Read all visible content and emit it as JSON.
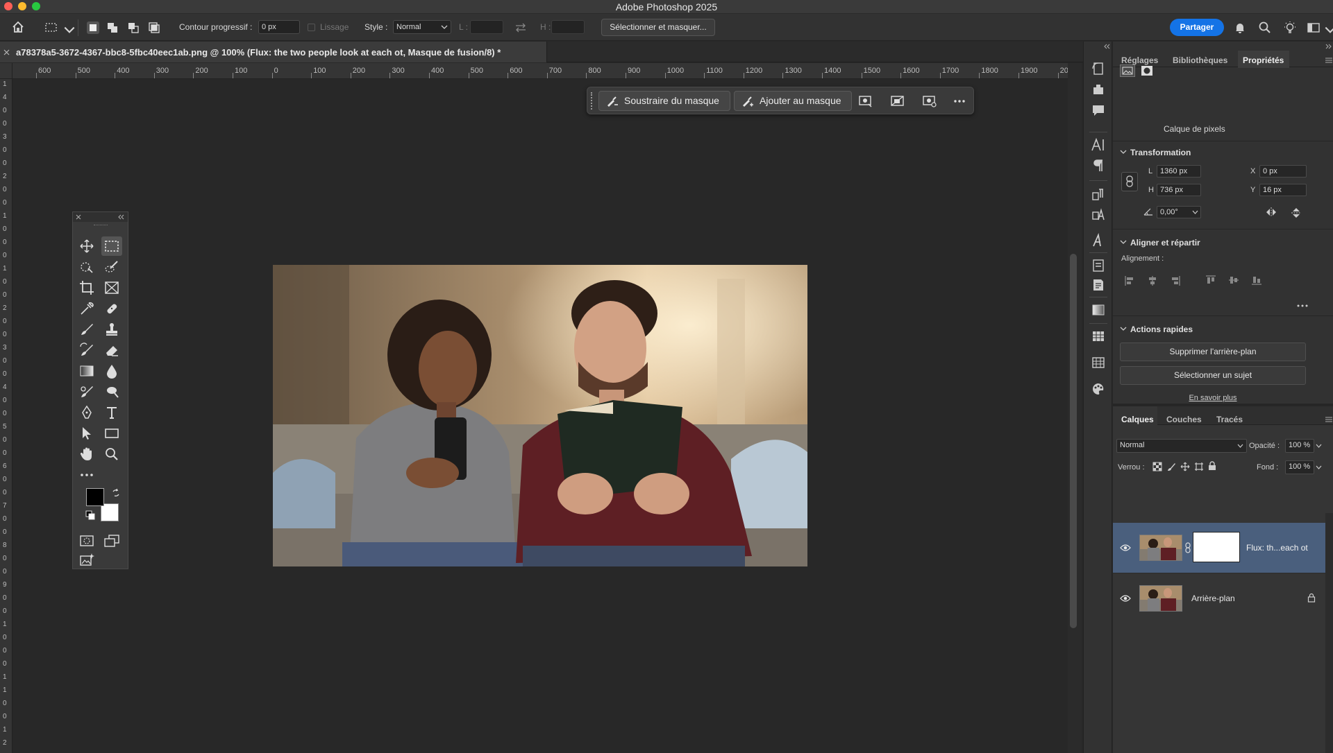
{
  "app": {
    "title": "Adobe Photoshop 2025"
  },
  "options_bar": {
    "feather_label": "Contour progressif :",
    "feather_value": "0 px",
    "antialias_label": "Lissage",
    "style_label": "Style :",
    "style_value": "Normal",
    "width_label": "L :",
    "height_label": "H :",
    "select_mask_button": "Sélectionner et masquer...",
    "share_button": "Partager"
  },
  "document": {
    "tab_title": "a78378a5-3672-4367-bbc8-5fbc40eec1ab.png @ 100% (Flux: the two people look at each ot, Masque de fusion/8) *"
  },
  "rulers": {
    "horizontal": [
      "600",
      "500",
      "400",
      "300",
      "200",
      "100",
      "0",
      "100",
      "200",
      "300",
      "400",
      "500",
      "600",
      "700",
      "800",
      "900",
      "1000",
      "1100",
      "1200",
      "1300",
      "1400",
      "1500",
      "1600",
      "1700",
      "1800",
      "1900",
      "20"
    ],
    "vertical": [
      "1",
      "4",
      "0",
      "0",
      "3",
      "0",
      "0",
      "2",
      "0",
      "0",
      "1",
      "0",
      "0",
      "0",
      "1",
      "0",
      "0",
      "2",
      "0",
      "0",
      "3",
      "0",
      "0",
      "4",
      "0",
      "0",
      "5",
      "0",
      "0",
      "6",
      "0",
      "0",
      "7",
      "0",
      "0",
      "8",
      "0",
      "0",
      "9",
      "0",
      "0",
      "1",
      "0",
      "0",
      "0",
      "1",
      "1",
      "0",
      "0",
      "1",
      "2"
    ]
  },
  "task_bar": {
    "subtract_label": "Soustraire du masque",
    "add_label": "Ajouter au masque"
  },
  "panels": {
    "top_tabs": [
      "Réglages",
      "Bibliothèques",
      "Propriétés"
    ],
    "active_top_tab": "Propriétés",
    "pixel_layer_label": "Calque de pixels",
    "transform": {
      "title": "Transformation",
      "w_label": "L",
      "w_value": "1360 px",
      "h_label": "H",
      "h_value": "736 px",
      "x_label": "X",
      "x_value": "0 px",
      "y_label": "Y",
      "y_value": "16 px",
      "angle_value": "0,00°"
    },
    "align": {
      "title": "Aligner et répartir",
      "alignment_label": "Alignement :"
    },
    "quick_actions": {
      "title": "Actions rapides",
      "remove_bg": "Supprimer l'arrière-plan",
      "select_subject": "Sélectionner un sujet",
      "learn_more": "En savoir plus"
    },
    "layers": {
      "tabs": [
        "Calques",
        "Couches",
        "Tracés"
      ],
      "active_tab": "Calques",
      "blend_mode": "Normal",
      "opacity_label": "Opacité :",
      "opacity_value": "100 %",
      "lock_label": "Verrou :",
      "fill_label": "Fond :",
      "fill_value": "100 %",
      "items": [
        {
          "name": "Flux: th...each ot",
          "selected": true
        },
        {
          "name": "Arrière-plan",
          "selected": false
        }
      ]
    }
  },
  "colors": {
    "accent": "#1473e6",
    "selected_layer": "#4a5f7d",
    "canvas_bg": "#282828"
  }
}
